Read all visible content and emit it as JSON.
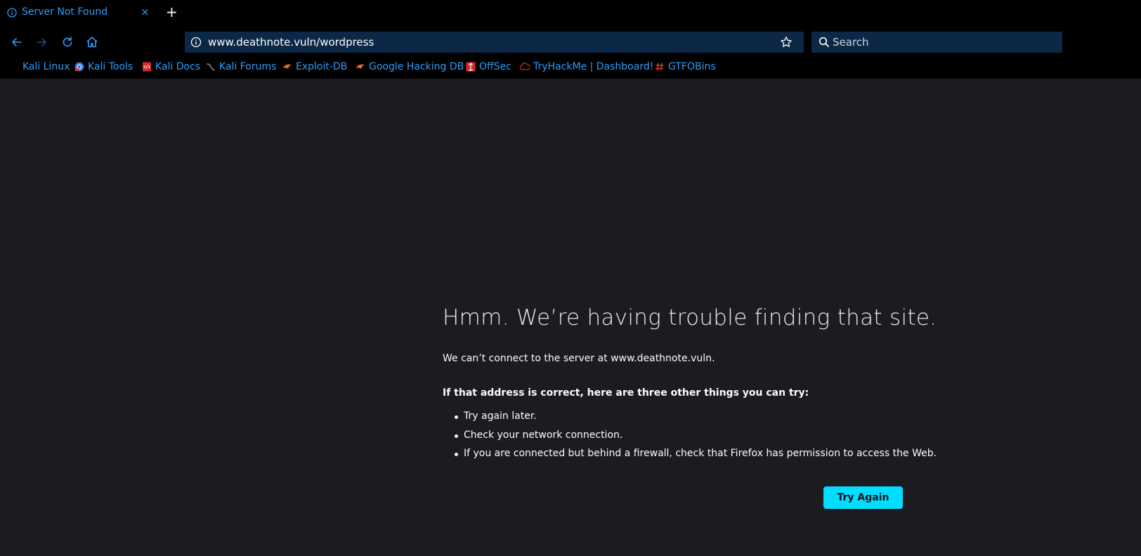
{
  "tab": {
    "title": "Server Not Found",
    "close": "×",
    "new_tab": "+"
  },
  "toolbar": {
    "url": "www.deathnote.vuln/wordpress",
    "search_placeholder": "Search"
  },
  "bookmarks": [
    {
      "label": "Kali Linux",
      "icon": "none"
    },
    {
      "label": "Kali Tools",
      "icon": "kali-tools-icon"
    },
    {
      "label": "Kali Docs",
      "icon": "kali-docs-icon"
    },
    {
      "label": "Kali Forums",
      "icon": "kali-forums-icon"
    },
    {
      "label": "Exploit-DB",
      "icon": "exploit-db-icon"
    },
    {
      "label": "Google Hacking DB",
      "icon": "ghdb-icon"
    },
    {
      "label": "OffSec",
      "icon": "offsec-icon"
    },
    {
      "label": "TryHackMe | Dashboard!",
      "icon": "tryhackme-icon"
    },
    {
      "label": "GTFOBins",
      "icon": "gtfobins-icon"
    }
  ],
  "error": {
    "title": "Hmm. We’re having trouble finding that site.",
    "description": "We can’t connect to the server at www.deathnote.vuln.",
    "heading": "If that address is correct, here are three other things you can try:",
    "items": [
      "Try again later.",
      "Check your network connection.",
      "If you are connected but behind a firewall, check that Firefox has permission to access the Web."
    ],
    "button": "Try Again"
  },
  "colors": {
    "accent": "#00ddff",
    "link": "#2f9cf8",
    "page_bg": "#1c1b22",
    "chrome_bg": "#000000",
    "field_bg": "#0d2847"
  }
}
